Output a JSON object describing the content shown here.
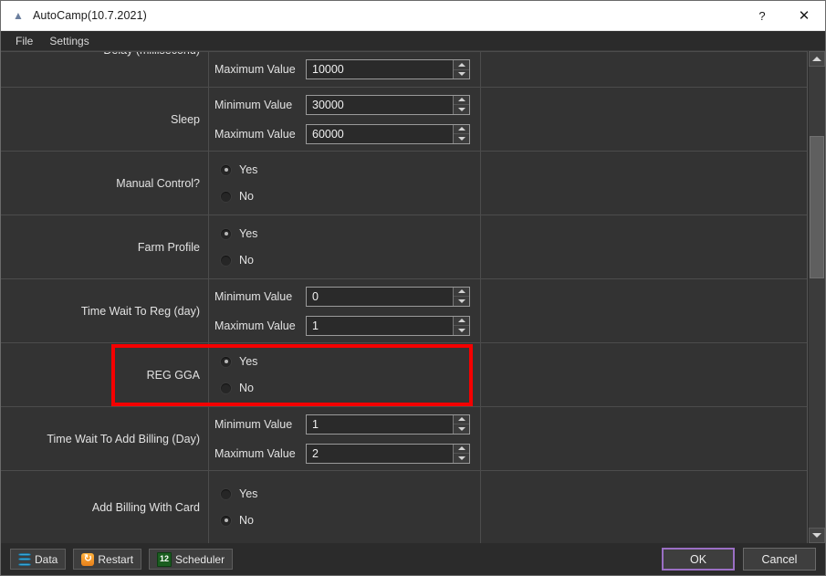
{
  "window": {
    "title": "AutoCamp(10.7.2021)",
    "app_icon": "app-icon",
    "help_label": "?",
    "close_label": "✕"
  },
  "menubar": {
    "items": [
      {
        "label": "File"
      },
      {
        "label": "Settings"
      }
    ]
  },
  "labels": {
    "minimum_value": "Minimum Value",
    "maximum_value": "Maximum Value",
    "yes": "Yes",
    "no": "No"
  },
  "rows": [
    {
      "name": "delay-milliseconds",
      "label": "Delay (millisecond)",
      "type": "numeric",
      "clipped": true,
      "fields": [
        {
          "label": "Maximum Value",
          "value": "10000"
        }
      ]
    },
    {
      "name": "sleep",
      "label": "Sleep",
      "type": "numeric",
      "fields": [
        {
          "label": "Minimum Value",
          "value": "30000"
        },
        {
          "label": "Maximum Value",
          "value": "60000"
        }
      ]
    },
    {
      "name": "manual-control",
      "label": "Manual Control?",
      "type": "radio",
      "options": [
        {
          "label": "Yes",
          "selected": true
        },
        {
          "label": "No",
          "selected": false
        }
      ]
    },
    {
      "name": "farm-profile",
      "label": "Farm Profile",
      "type": "radio",
      "options": [
        {
          "label": "Yes",
          "selected": true
        },
        {
          "label": "No",
          "selected": false
        }
      ]
    },
    {
      "name": "time-wait-to-reg-day",
      "label": "Time Wait To Reg (day)",
      "type": "numeric",
      "fields": [
        {
          "label": "Minimum Value",
          "value": "0"
        },
        {
          "label": "Maximum Value",
          "value": "1"
        }
      ]
    },
    {
      "name": "reg-gga",
      "label": "REG GGA",
      "type": "radio",
      "highlighted": true,
      "options": [
        {
          "label": "Yes",
          "selected": true
        },
        {
          "label": "No",
          "selected": false
        }
      ]
    },
    {
      "name": "time-wait-to-add-billing-day",
      "label": "Time Wait To Add Billing (Day)",
      "type": "numeric",
      "fields": [
        {
          "label": "Minimum Value",
          "value": "1"
        },
        {
          "label": "Maximum Value",
          "value": "2"
        }
      ]
    },
    {
      "name": "add-billing-with-card",
      "label": "Add Billing With Card",
      "type": "radio",
      "options": [
        {
          "label": "Yes",
          "selected": false
        },
        {
          "label": "No",
          "selected": true
        }
      ]
    }
  ],
  "annotation": {
    "color": "#f50000",
    "target_row": "reg-gga"
  },
  "scrollbar": {
    "up_arrow": "▲",
    "down_arrow": "▼",
    "thumb_top_pct": 15,
    "thumb_height_pct": 31
  },
  "toolbar": {
    "buttons": [
      {
        "label": "Data",
        "icon": "database-icon"
      },
      {
        "label": "Restart",
        "icon": "refresh-icon"
      },
      {
        "label": "Scheduler",
        "icon": "calendar-icon",
        "icon_text": "12"
      }
    ]
  },
  "dialog_buttons": {
    "ok": "OK",
    "cancel": "Cancel"
  }
}
